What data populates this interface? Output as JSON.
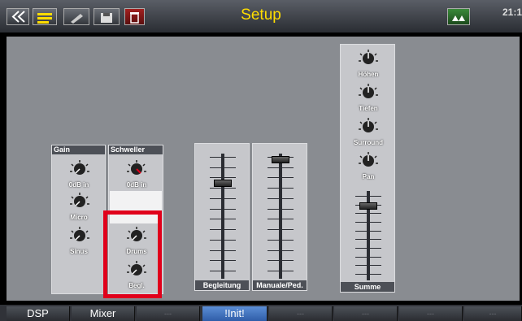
{
  "header": {
    "title": "Setup",
    "clock": "21:1"
  },
  "icons": {
    "back": "double-chevron-left-icon",
    "menu": "menu-icon",
    "edit": "edit-icon",
    "disk": "disk-icon",
    "trash": "trash-icon",
    "grid": "grid-icon"
  },
  "header_button_labels": {
    "menu": "MENU",
    "edit": "EDIT",
    "disk": "USB/HDD"
  },
  "panels": {
    "gain": {
      "title": "Gain",
      "knobs": [
        "0dB in",
        "Micro",
        "Sinus"
      ]
    },
    "schweller": {
      "title": "Schweller",
      "knobs": [
        "0dB in",
        "Drums",
        "Begl."
      ]
    },
    "begleitung": {
      "footer": "Begleitung"
    },
    "manuale": {
      "footer": "Manuale/Ped."
    },
    "summe": {
      "knobs": [
        "Höhen",
        "Tiefen",
        "Surround",
        "Pan"
      ],
      "footer": "Summe"
    }
  },
  "tabs": [
    {
      "label": "DSP"
    },
    {
      "label": "Mixer"
    },
    {
      "label": "---"
    },
    {
      "label": "!Init!"
    },
    {
      "label": "---"
    },
    {
      "label": "---"
    },
    {
      "label": "---"
    },
    {
      "label": "---"
    }
  ],
  "colors": {
    "title": "#ffdd00",
    "highlight": "#e0001b",
    "active_tab": "#3a6cbc"
  }
}
